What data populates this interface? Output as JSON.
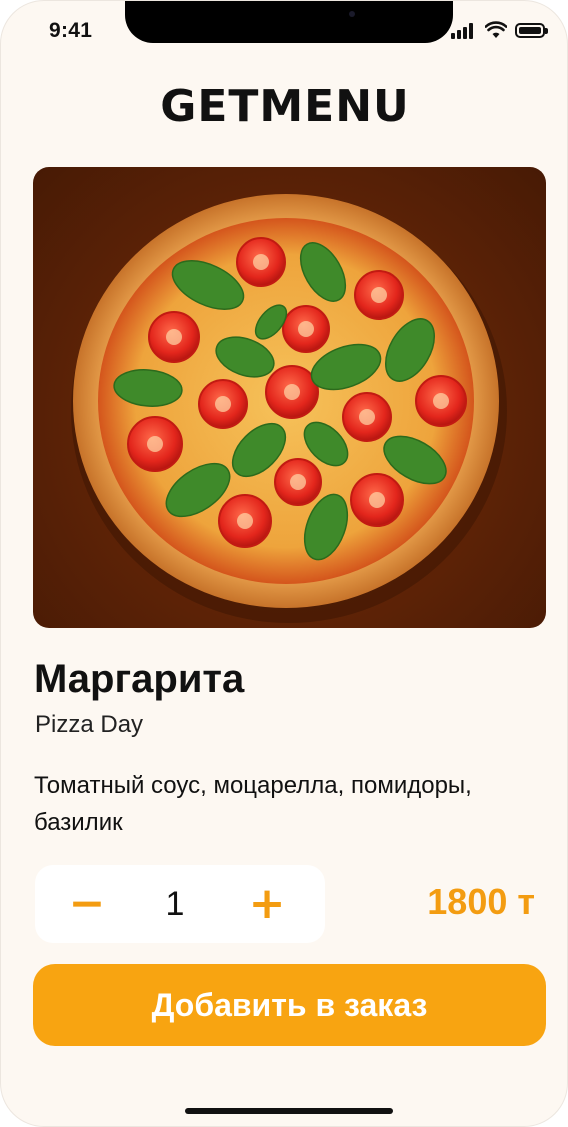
{
  "status_bar": {
    "time": "9:41"
  },
  "header": {
    "logo": "GETMENU"
  },
  "product": {
    "image_icon": "pizza-margherita-image",
    "title": "Маргарита",
    "vendor": "Pizza Day",
    "description": "Томатный соус, моцарелла, помидоры, базилик"
  },
  "order": {
    "minus_label": "−",
    "quantity": "1",
    "plus_label": "+",
    "price": "1800 т",
    "add_button_label": "Добавить в заказ"
  },
  "colors": {
    "accent": "#f8a411",
    "background": "#fdf8f2"
  }
}
